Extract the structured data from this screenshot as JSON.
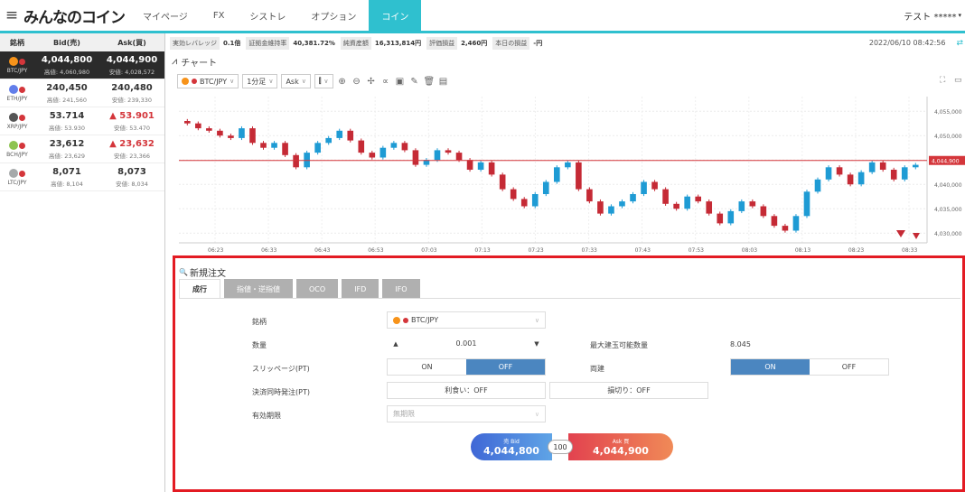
{
  "topnav": {
    "menu_icon": "hamburger-icon",
    "logo": "みんなのコイン",
    "tabs": [
      "マイページ",
      "FX",
      "シストレ",
      "オプション",
      "コイン"
    ],
    "active_tab": "コイン",
    "user": "テスト *****"
  },
  "rates": {
    "headers": [
      "銘柄",
      "Bid(売)",
      "Ask(買)"
    ],
    "rows": [
      {
        "pair": "BTC/JPY",
        "bid": "4,044,800",
        "ask": "4,044,900",
        "bid_sub": "高値: 4,060,980",
        "ask_sub": "安値: 4,028,572",
        "ask_up": false,
        "color": "#f7931a",
        "selected": true
      },
      {
        "pair": "ETH/JPY",
        "bid": "240,450",
        "ask": "240,480",
        "bid_sub": "高値: 241,560",
        "ask_sub": "安値: 239,330",
        "ask_up": false,
        "color": "#627eea",
        "selected": false
      },
      {
        "pair": "XRP/JPY",
        "bid": "53.714",
        "ask": "▲ 53.901",
        "bid_sub": "高値: 53.930",
        "ask_sub": "安値: 53.470",
        "ask_up": true,
        "color": "#555555",
        "selected": false
      },
      {
        "pair": "BCH/JPY",
        "bid": "23,612",
        "ask": "▲ 23,632",
        "bid_sub": "高値: 23,629",
        "ask_sub": "安値: 23,366",
        "ask_up": true,
        "color": "#8dc351",
        "selected": false
      },
      {
        "pair": "LTC/JPY",
        "bid": "8,071",
        "ask": "8,073",
        "bid_sub": "高値: 8,104",
        "ask_sub": "安値: 8,034",
        "ask_up": false,
        "color": "#a6a9aa",
        "selected": false
      }
    ]
  },
  "infobar": {
    "items": [
      {
        "label": "実効レバレッジ",
        "value": "0.1倍"
      },
      {
        "label": "証拠金維持率",
        "value": "40,381.72%"
      },
      {
        "label": "純資産額",
        "value": "16,313,814円"
      },
      {
        "label": "評価損益",
        "value": "2,460円"
      },
      {
        "label": "本日の損益",
        "value": "-円"
      }
    ],
    "datetime": "2022/06/10 08:42:56"
  },
  "chart": {
    "title": "チャート",
    "symbol": "BTC/JPY",
    "interval": "1分足",
    "side": "Ask",
    "price_labels": [
      "4,055,000",
      "4,050,000",
      "4,045,000",
      "4,040,000",
      "4,035,000",
      "4,030,000"
    ],
    "current_price_label": "4,044,900",
    "time_labels": [
      "06:23",
      "06:33",
      "06:43",
      "06:53",
      "07:03",
      "07:13",
      "07:23",
      "07:33",
      "07:43",
      "07:53",
      "08:03",
      "08:13",
      "08:23",
      "08:33"
    ]
  },
  "chart_data": {
    "type": "candlestick",
    "ylim": [
      4028000,
      4058000
    ],
    "closes": [
      4052500,
      4051500,
      4051000,
      4050000,
      4049500,
      4051500,
      4048500,
      4047500,
      4048500,
      4046000,
      4043500,
      4046500,
      4048500,
      4049500,
      4051000,
      4049000,
      4046500,
      4045500,
      4047500,
      4048500,
      4047000,
      4044000,
      4045000,
      4047000,
      4046500,
      4045000,
      4043000,
      4044500,
      4042000,
      4039000,
      4037000,
      4035500,
      4038000,
      4040500,
      4043500,
      4044500,
      4039000,
      4036500,
      4034000,
      4035500,
      4036500,
      4038000,
      4040500,
      4039000,
      4036000,
      4035000,
      4037500,
      4036500,
      4034000,
      4032000,
      4034500,
      4036500,
      4035500,
      4033500,
      4031500,
      4030500,
      4033500,
      4038500,
      4041000,
      4043500,
      4042000,
      4040000,
      4042500,
      4044500,
      4043000,
      4041000,
      4043500,
      4044000
    ],
    "opens": [
      4053000,
      4052500,
      4051500,
      4051000,
      4050000,
      4049500,
      4051500,
      4048500,
      4047500,
      4048500,
      4046000,
      4043500,
      4046500,
      4048500,
      4049500,
      4051000,
      4049000,
      4046500,
      4045500,
      4047500,
      4048500,
      4047000,
      4044000,
      4045000,
      4047000,
      4046500,
      4045000,
      4043000,
      4044500,
      4042000,
      4039000,
      4037000,
      4035500,
      4038000,
      4040500,
      4043500,
      4044500,
      4039000,
      4036500,
      4034000,
      4035500,
      4036500,
      4038000,
      4040500,
      4039000,
      4036000,
      4035000,
      4037500,
      4036500,
      4034000,
      4032000,
      4034500,
      4036500,
      4035500,
      4033500,
      4031500,
      4030500,
      4033500,
      4038500,
      4041000,
      4043500,
      4042000,
      4040000,
      4042500,
      4044500,
      4043000,
      4041000,
      4043500
    ]
  },
  "order": {
    "title": "新規注文",
    "tabs": [
      "成行",
      "指値・逆指値",
      "OCO",
      "IFD",
      "IFO"
    ],
    "active_tab": "成行",
    "labels": {
      "symbol": "銘柄",
      "quantity": "数量",
      "slippage": "スリッページ(PT)",
      "settle": "決済同時発注(PT)",
      "expiry": "有効期限",
      "max_qty": "最大建玉可能数量",
      "both": "両建"
    },
    "symbol_value": "BTC/JPY",
    "quantity_value": "0.001",
    "max_qty_value": "8.045",
    "slippage_on": "ON",
    "slippage_off": "OFF",
    "both_on": "ON",
    "both_off": "OFF",
    "take_profit": "利食い：OFF",
    "stop_loss": "損切り：OFF",
    "expiry_value": "無期限",
    "sell_label": "売 Bid",
    "sell_price": "4,044,800",
    "buy_label": "Ask 買",
    "buy_price": "4,044,900",
    "spread_qty": "100"
  },
  "colors": {
    "accent": "#2fc0cf",
    "up_candle": "#1e9bd4",
    "down_candle": "#c52a35",
    "highlight": "#e31b23"
  }
}
